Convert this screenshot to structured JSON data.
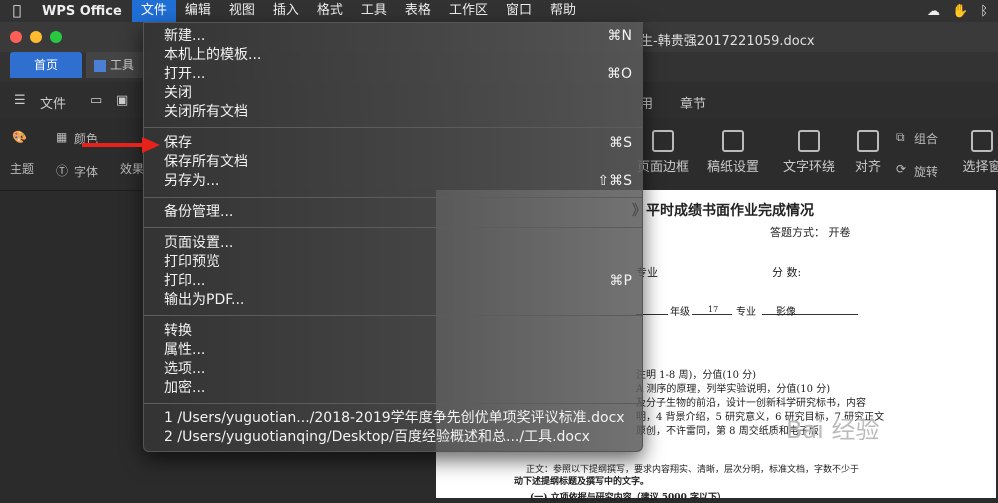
{
  "menubar": {
    "app": "WPS Office",
    "items": [
      "文件",
      "编辑",
      "视图",
      "插入",
      "格式",
      "工具",
      "表格",
      "工作区",
      "窗口",
      "帮助"
    ],
    "active": "文件"
  },
  "window": {
    "doc_title": "生-韩贵强2017221059.docx"
  },
  "tabs": {
    "home": "首页",
    "doc": "工具"
  },
  "ribbon": {
    "file": "文件",
    "chapter": "章节"
  },
  "toolbar": {
    "color": "颜色",
    "theme": "主题",
    "font": "字体",
    "effect": "效果",
    "page_border": "页面边框",
    "grid_setting": "稿纸设置",
    "text_wrap": "文字环绕",
    "align": "对齐",
    "group": "组合",
    "rotate": "旋转",
    "select": "选择窗"
  },
  "menu": {
    "sections": [
      [
        {
          "label": "新建...",
          "shortcut": "⌘N"
        },
        {
          "label": "本机上的模板...",
          "shortcut": ""
        },
        {
          "label": "打开...",
          "shortcut": "⌘O"
        },
        {
          "label": "关闭",
          "shortcut": ""
        },
        {
          "label": "关闭所有文档",
          "shortcut": ""
        }
      ],
      [
        {
          "label": "保存",
          "shortcut": "⌘S"
        },
        {
          "label": "保存所有文档",
          "shortcut": ""
        },
        {
          "label": "另存为...",
          "shortcut": "⇧⌘S"
        }
      ],
      [
        {
          "label": "备份管理...",
          "shortcut": ""
        }
      ],
      [
        {
          "label": "页面设置...",
          "shortcut": ""
        },
        {
          "label": "打印预览",
          "shortcut": ""
        },
        {
          "label": "打印...",
          "shortcut": "⌘P"
        },
        {
          "label": "输出为PDF...",
          "shortcut": ""
        }
      ],
      [
        {
          "label": "转换",
          "shortcut": ""
        },
        {
          "label": "属性...",
          "shortcut": ""
        },
        {
          "label": "选项...",
          "shortcut": ""
        },
        {
          "label": "加密...",
          "shortcut": ""
        }
      ],
      [
        {
          "label": "1 /Users/yuguotian.../2018-2019学年度争先创优单项奖评议标准.docx",
          "shortcut": ""
        },
        {
          "label": "2 /Users/yuguotianqing/Desktop/百度经验概述和总.../工具.docx",
          "shortcut": ""
        }
      ]
    ]
  },
  "document": {
    "heading": "》平时成绩书面作业完成情况",
    "answer_mode": "答题方式： 开卷",
    "major": "专业",
    "score": "分       数:",
    "grade": "年级",
    "grade_val": "17",
    "major2": "专业",
    "major_val": "影像",
    "line1": "注明 1-8 周)，分值(10 分)",
    "line2": "A 测序的原理，列举实验说明，分值(10 分)",
    "line3": "及分子生物的前沿，设计一创新科学研究标书，内容",
    "line4": "明，4 背景介绍，5 研究意义，6 研究目标，7 研究正文",
    "line5": "原创，不许雷同，第 8 周交纸质和电子版",
    "body_note": "正文：参照以下提纲撰写，要求内容翔实、清晰，层次分明，标准文档，字数不少于",
    "body_note2": "动下述提纲标题及撰写中的文字。",
    "section": "(一) 立项依据与研究内容（建议 5000 字以下）",
    "watermark": "Bai 经验"
  }
}
